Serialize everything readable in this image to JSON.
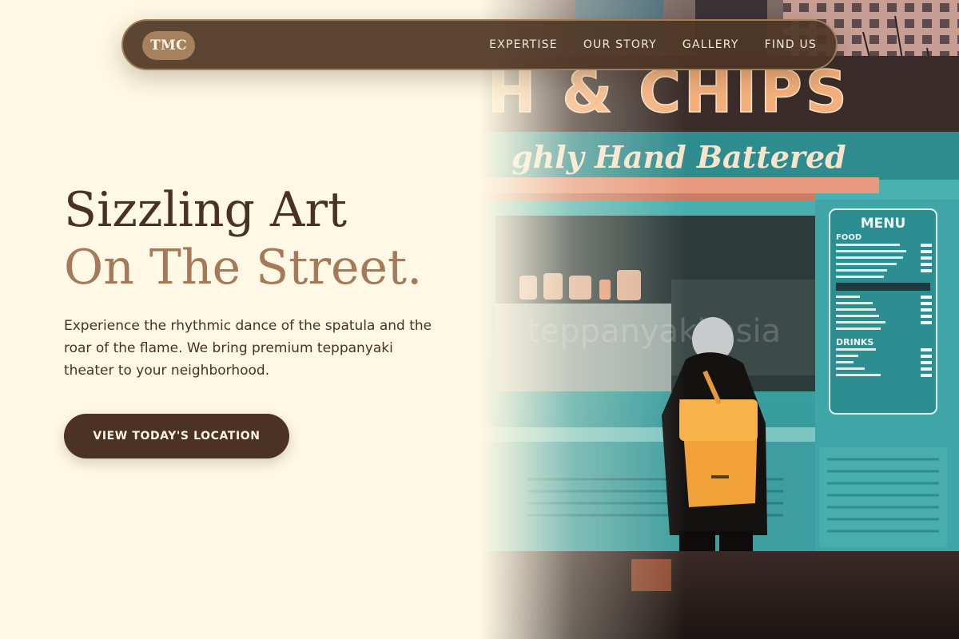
{
  "nav": {
    "logo": "TMC",
    "links": [
      "EXPERTISE",
      "OUR STORY",
      "GALLERY",
      "FIND US"
    ]
  },
  "hero": {
    "title_line1": "Sizzling Art",
    "title_line2": "On The Street.",
    "intro": "Experience the rhythmic dance of the spatula and the roar of the flame. We bring premium teppanyaki theater to your neighborhood.",
    "cta_label": "VIEW TODAY'S LOCATION"
  },
  "photo": {
    "sign_top": "H & CHIPS",
    "sign_script": "ghly Hand Battered",
    "menu": {
      "title": "MENU",
      "food_heading": "FOOD",
      "drinks_heading": "DRINKS"
    },
    "watermark": "teppanyaki.asia"
  },
  "colors": {
    "background": "#FEF8E4",
    "brand_dark": "#4C3222",
    "accent": "#A5795A",
    "nav_bg": "#4E3624",
    "truck_teal": "#3FA7A6"
  },
  "icons": {
    "logo": "tmc-badge"
  }
}
